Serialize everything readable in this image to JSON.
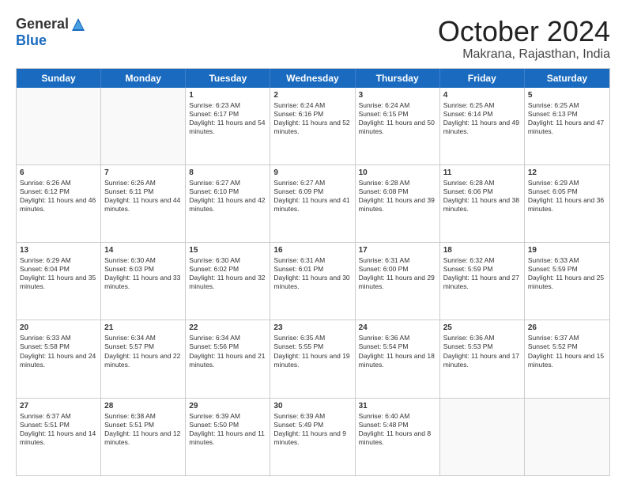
{
  "logo": {
    "general": "General",
    "blue": "Blue"
  },
  "title": "October 2024",
  "location": "Makrana, Rajasthan, India",
  "days": [
    "Sunday",
    "Monday",
    "Tuesday",
    "Wednesday",
    "Thursday",
    "Friday",
    "Saturday"
  ],
  "weeks": [
    [
      {
        "day": "",
        "info": ""
      },
      {
        "day": "",
        "info": ""
      },
      {
        "day": "1",
        "info": "Sunrise: 6:23 AM\nSunset: 6:17 PM\nDaylight: 11 hours and 54 minutes."
      },
      {
        "day": "2",
        "info": "Sunrise: 6:24 AM\nSunset: 6:16 PM\nDaylight: 11 hours and 52 minutes."
      },
      {
        "day": "3",
        "info": "Sunrise: 6:24 AM\nSunset: 6:15 PM\nDaylight: 11 hours and 50 minutes."
      },
      {
        "day": "4",
        "info": "Sunrise: 6:25 AM\nSunset: 6:14 PM\nDaylight: 11 hours and 49 minutes."
      },
      {
        "day": "5",
        "info": "Sunrise: 6:25 AM\nSunset: 6:13 PM\nDaylight: 11 hours and 47 minutes."
      }
    ],
    [
      {
        "day": "6",
        "info": "Sunrise: 6:26 AM\nSunset: 6:12 PM\nDaylight: 11 hours and 46 minutes."
      },
      {
        "day": "7",
        "info": "Sunrise: 6:26 AM\nSunset: 6:11 PM\nDaylight: 11 hours and 44 minutes."
      },
      {
        "day": "8",
        "info": "Sunrise: 6:27 AM\nSunset: 6:10 PM\nDaylight: 11 hours and 42 minutes."
      },
      {
        "day": "9",
        "info": "Sunrise: 6:27 AM\nSunset: 6:09 PM\nDaylight: 11 hours and 41 minutes."
      },
      {
        "day": "10",
        "info": "Sunrise: 6:28 AM\nSunset: 6:08 PM\nDaylight: 11 hours and 39 minutes."
      },
      {
        "day": "11",
        "info": "Sunrise: 6:28 AM\nSunset: 6:06 PM\nDaylight: 11 hours and 38 minutes."
      },
      {
        "day": "12",
        "info": "Sunrise: 6:29 AM\nSunset: 6:05 PM\nDaylight: 11 hours and 36 minutes."
      }
    ],
    [
      {
        "day": "13",
        "info": "Sunrise: 6:29 AM\nSunset: 6:04 PM\nDaylight: 11 hours and 35 minutes."
      },
      {
        "day": "14",
        "info": "Sunrise: 6:30 AM\nSunset: 6:03 PM\nDaylight: 11 hours and 33 minutes."
      },
      {
        "day": "15",
        "info": "Sunrise: 6:30 AM\nSunset: 6:02 PM\nDaylight: 11 hours and 32 minutes."
      },
      {
        "day": "16",
        "info": "Sunrise: 6:31 AM\nSunset: 6:01 PM\nDaylight: 11 hours and 30 minutes."
      },
      {
        "day": "17",
        "info": "Sunrise: 6:31 AM\nSunset: 6:00 PM\nDaylight: 11 hours and 29 minutes."
      },
      {
        "day": "18",
        "info": "Sunrise: 6:32 AM\nSunset: 5:59 PM\nDaylight: 11 hours and 27 minutes."
      },
      {
        "day": "19",
        "info": "Sunrise: 6:33 AM\nSunset: 5:59 PM\nDaylight: 11 hours and 25 minutes."
      }
    ],
    [
      {
        "day": "20",
        "info": "Sunrise: 6:33 AM\nSunset: 5:58 PM\nDaylight: 11 hours and 24 minutes."
      },
      {
        "day": "21",
        "info": "Sunrise: 6:34 AM\nSunset: 5:57 PM\nDaylight: 11 hours and 22 minutes."
      },
      {
        "day": "22",
        "info": "Sunrise: 6:34 AM\nSunset: 5:56 PM\nDaylight: 11 hours and 21 minutes."
      },
      {
        "day": "23",
        "info": "Sunrise: 6:35 AM\nSunset: 5:55 PM\nDaylight: 11 hours and 19 minutes."
      },
      {
        "day": "24",
        "info": "Sunrise: 6:36 AM\nSunset: 5:54 PM\nDaylight: 11 hours and 18 minutes."
      },
      {
        "day": "25",
        "info": "Sunrise: 6:36 AM\nSunset: 5:53 PM\nDaylight: 11 hours and 17 minutes."
      },
      {
        "day": "26",
        "info": "Sunrise: 6:37 AM\nSunset: 5:52 PM\nDaylight: 11 hours and 15 minutes."
      }
    ],
    [
      {
        "day": "27",
        "info": "Sunrise: 6:37 AM\nSunset: 5:51 PM\nDaylight: 11 hours and 14 minutes."
      },
      {
        "day": "28",
        "info": "Sunrise: 6:38 AM\nSunset: 5:51 PM\nDaylight: 11 hours and 12 minutes."
      },
      {
        "day": "29",
        "info": "Sunrise: 6:39 AM\nSunset: 5:50 PM\nDaylight: 11 hours and 11 minutes."
      },
      {
        "day": "30",
        "info": "Sunrise: 6:39 AM\nSunset: 5:49 PM\nDaylight: 11 hours and 9 minutes."
      },
      {
        "day": "31",
        "info": "Sunrise: 6:40 AM\nSunset: 5:48 PM\nDaylight: 11 hours and 8 minutes."
      },
      {
        "day": "",
        "info": ""
      },
      {
        "day": "",
        "info": ""
      }
    ]
  ]
}
